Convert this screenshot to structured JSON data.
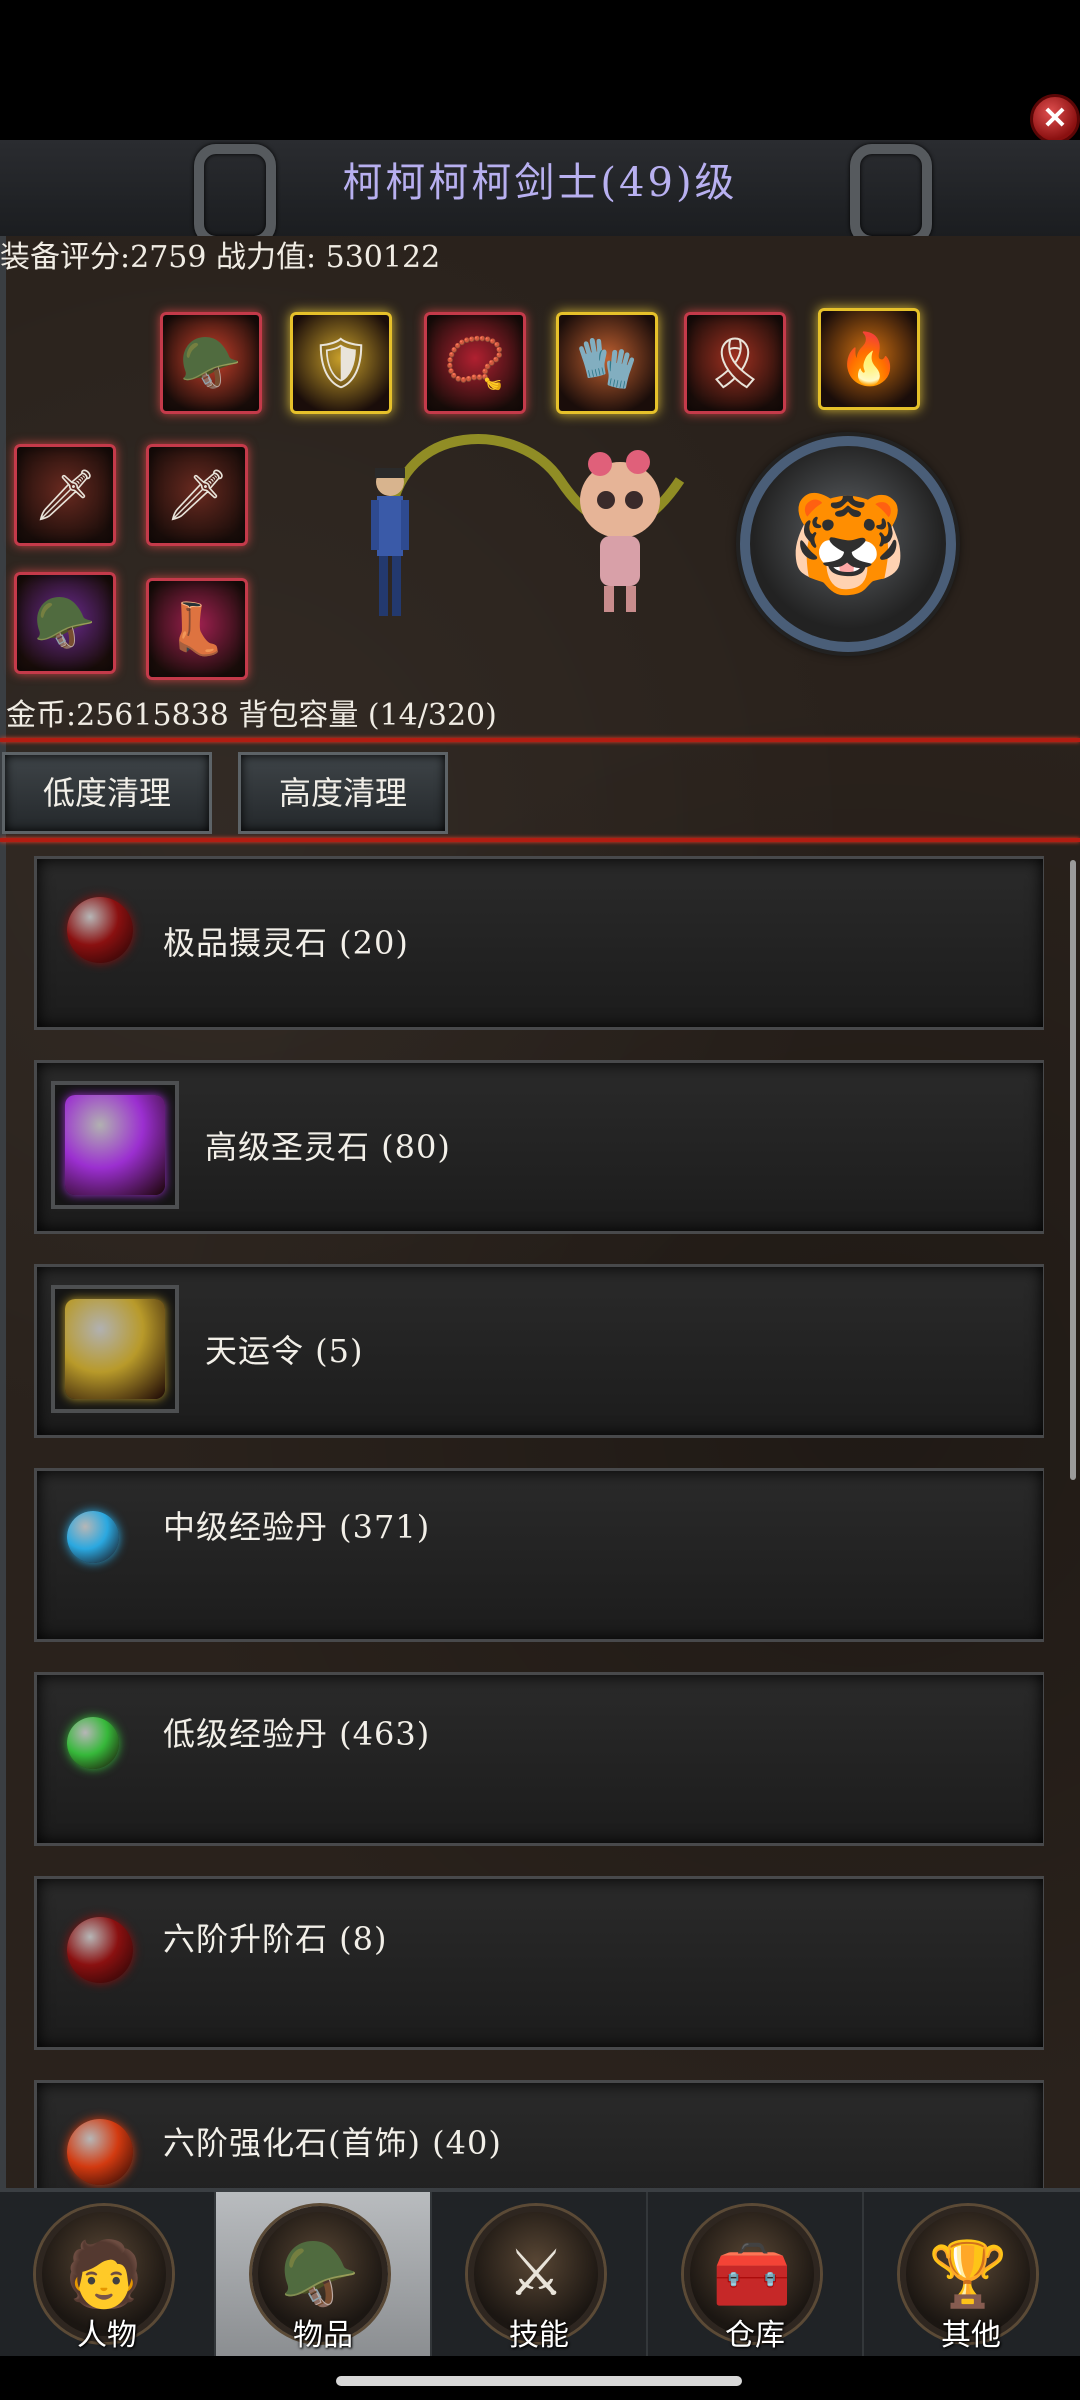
{
  "header": {
    "title": "柯柯柯柯剑士(49)级",
    "close_icon": "close-icon"
  },
  "stats": {
    "equipment_score_line": "装备评分:2759 战力值: 530122",
    "gold_line": "金币:25615838 背包容量 (14/320)"
  },
  "equipment_slots": [
    {
      "name": "helmet-icon",
      "glyph": "🪖",
      "color": "#c9402a"
    },
    {
      "name": "armor-icon",
      "glyph": "🛡",
      "color": "#c9a02a"
    },
    {
      "name": "necklace-icon",
      "glyph": "📿",
      "color": "#b02030"
    },
    {
      "name": "gauntlet-icon",
      "glyph": "🧤",
      "color": "#c06030"
    },
    {
      "name": "belt-icon",
      "glyph": "🎗",
      "color": "#a03020"
    },
    {
      "name": "fire-orb-icon",
      "glyph": "🔥",
      "color": "#d07010"
    },
    {
      "name": "sword-icon",
      "glyph": "🗡",
      "color": "#6a2a20"
    },
    {
      "name": "dagger-icon",
      "glyph": "🗡",
      "color": "#6a2a20"
    },
    {
      "name": "purple-helm-icon",
      "glyph": "🪖",
      "color": "#6a2a90"
    },
    {
      "name": "boots-icon",
      "glyph": "👢",
      "color": "#a02050"
    }
  ],
  "buttons": {
    "low_clean": "低度清理",
    "high_clean": "高度清理"
  },
  "items": [
    {
      "label": "极品摄灵石 (20)",
      "icon": "red-stone-icon",
      "color": "#8a1010",
      "style": "round"
    },
    {
      "label": "高级圣灵石 (80)",
      "icon": "purple-crystal-icon",
      "color": "#9b2fd0",
      "style": "box"
    },
    {
      "label": "天运令 (5)",
      "icon": "gold-token-icon",
      "color": "#b89a2a",
      "style": "box"
    },
    {
      "label": "中级经验丹 (371)",
      "icon": "blue-pill-icon",
      "color": "#2aa8e0",
      "style": "round"
    },
    {
      "label": "低级经验丹 (463)",
      "icon": "green-pill-icon",
      "color": "#36b83a",
      "style": "round"
    },
    {
      "label": "六阶升阶石 (8)",
      "icon": "red-stone-icon",
      "color": "#8a1010",
      "style": "round"
    },
    {
      "label": "六阶强化石(首饰) (40)",
      "icon": "flame-stone-icon",
      "color": "#d23a10",
      "style": "round"
    }
  ],
  "nav": [
    {
      "label": "人物",
      "icon": "character-icon",
      "glyph": "🧑"
    },
    {
      "label": "物品",
      "icon": "items-helmet-icon",
      "glyph": "🪖"
    },
    {
      "label": "技能",
      "icon": "skill-sword-icon",
      "glyph": "⚔"
    },
    {
      "label": "仓库",
      "icon": "warehouse-chest-icon",
      "glyph": "🧰"
    },
    {
      "label": "其他",
      "icon": "trophy-icon",
      "glyph": "🏆"
    }
  ],
  "active_nav": "物品",
  "mount_icon": "tiger-head-icon",
  "pet_icon": "pet-fairy-icon",
  "character_icon": "player-character-icon"
}
